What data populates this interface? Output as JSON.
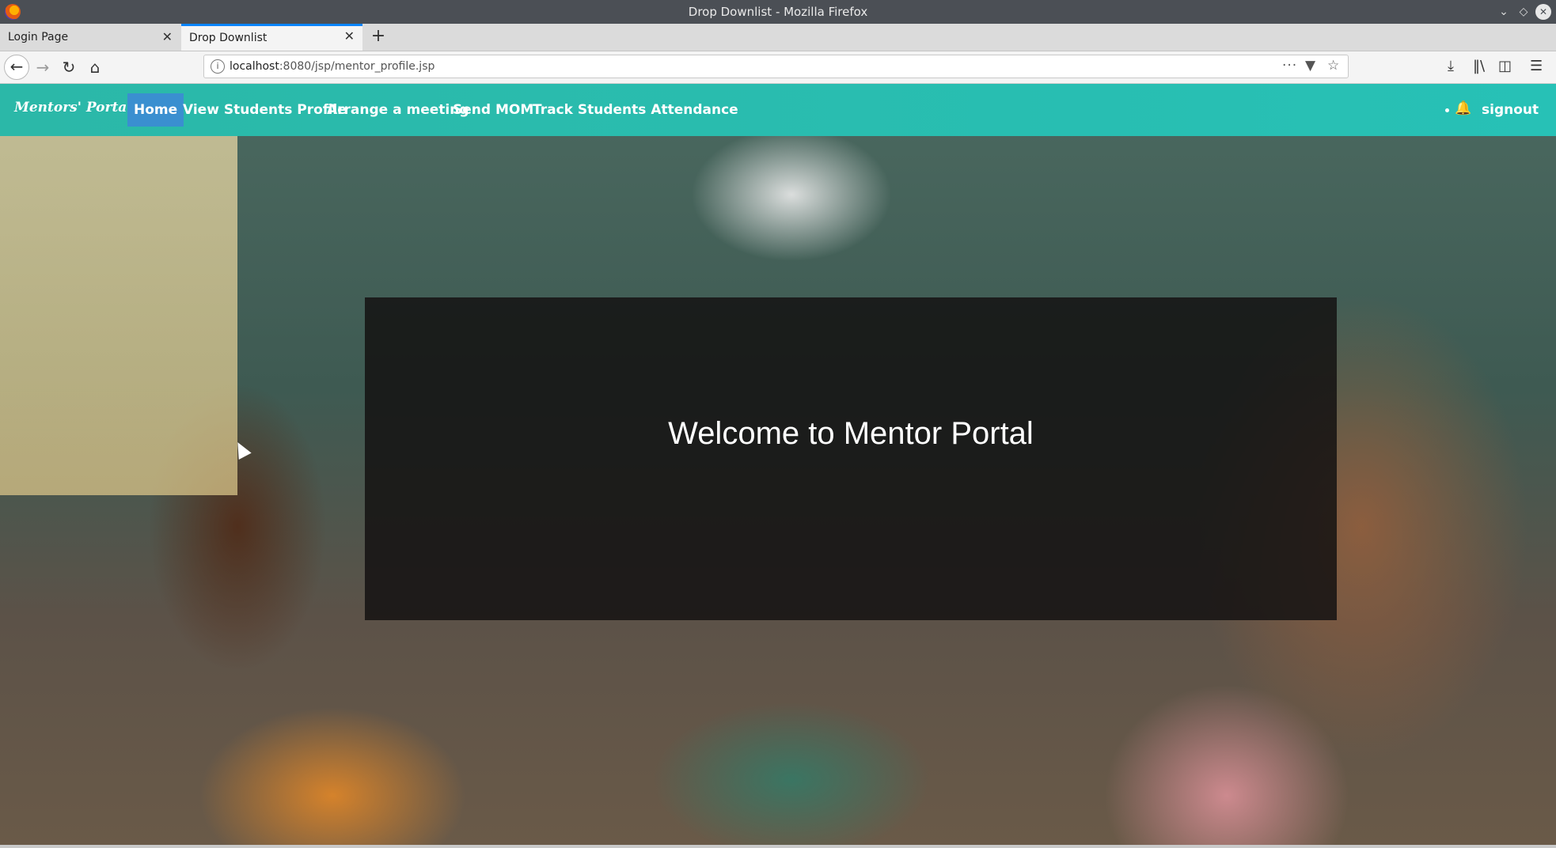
{
  "window": {
    "title": "Drop Downlist - Mozilla Firefox"
  },
  "tabs": [
    {
      "label": "Login Page"
    },
    {
      "label": "Drop Downlist"
    }
  ],
  "toolbar": {
    "url_host": "localhost",
    "url_path": ":8080/jsp/mentor_profile.jsp"
  },
  "site": {
    "brand": "Mentors' Portal",
    "nav": [
      "Home",
      "View Students Profile",
      "Arrange a meeting",
      "Send MOM",
      "Track Students Attendance"
    ],
    "signout": "signout"
  },
  "hero": {
    "welcome": "Welcome to Mentor Portal"
  },
  "colors": {
    "nav_bg": "#27c1b6",
    "active_link": "#3a8fd0",
    "bell": "#1f6fe0"
  }
}
